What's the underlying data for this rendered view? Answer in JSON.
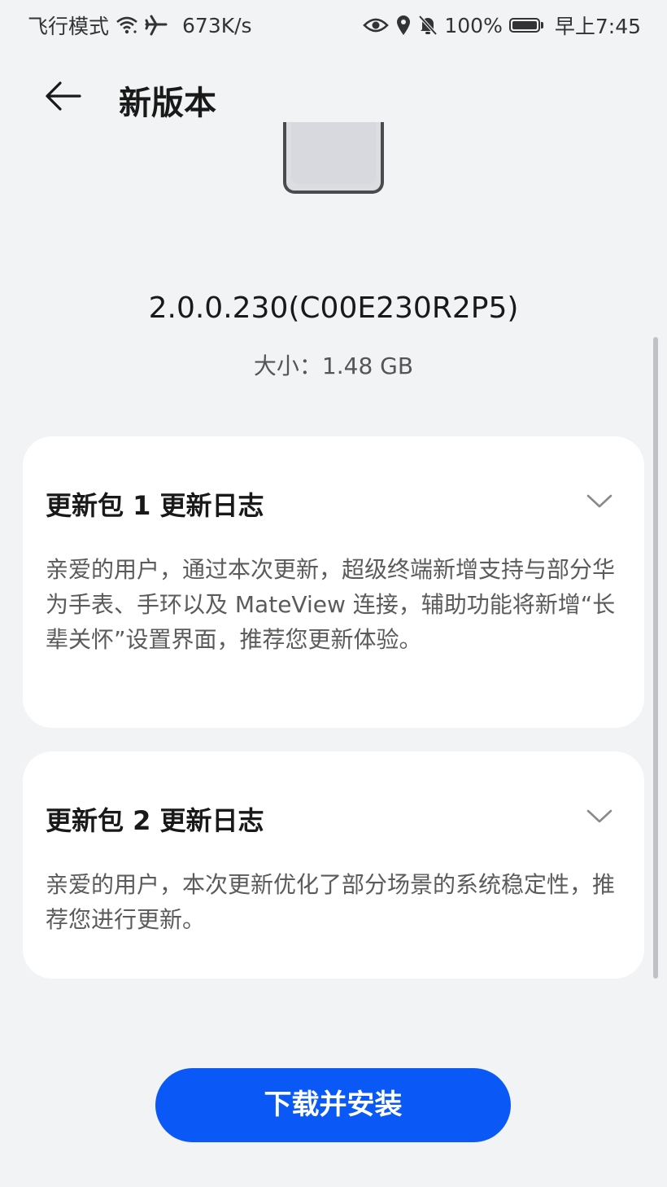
{
  "status_bar": {
    "mode_label": "飞行模式",
    "speed": "673K/s",
    "battery": "100%",
    "time": "早上7:45"
  },
  "header": {
    "title": "新版本"
  },
  "version": {
    "number": "2.0.0.230(C00E230R2P5)",
    "size": "大小：1.48 GB"
  },
  "packages": [
    {
      "title": "更新包 1 更新日志",
      "body": "亲爱的用户，通过本次更新，超级终端新增支持与部分华为手表、手环以及 MateView 连接，辅助功能将新增“长辈关怀”设置界面，推荐您更新体验。"
    },
    {
      "title": "更新包 2 更新日志",
      "body": "亲爱的用户，本次更新优化了部分场景的系统稳定性，推荐您进行更新。"
    }
  ],
  "install_button": {
    "label": "下载并安装"
  },
  "colors": {
    "accent": "#0a59f7",
    "background": "#f1f3f5",
    "card": "#ffffff"
  }
}
